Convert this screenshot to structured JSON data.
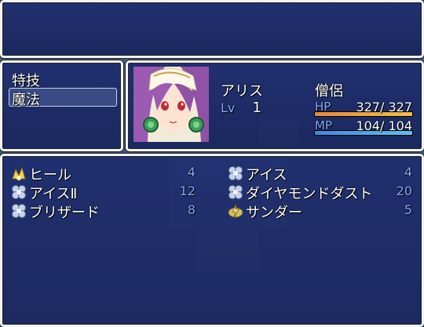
{
  "help_window": {
    "text": ""
  },
  "skill_types": {
    "items": [
      {
        "label": "特技"
      },
      {
        "label": "魔法"
      }
    ],
    "selected_index": 1
  },
  "actor": {
    "name": "アリス",
    "class": "僧侶",
    "level_label": "Lv",
    "level": "1",
    "hp_label": "HP",
    "hp_value": "327/ 327",
    "hp_ratio": 1.0,
    "mp_label": "MP",
    "mp_value": "104/ 104",
    "mp_ratio": 1.0
  },
  "skills": [
    {
      "name": "ヒール",
      "cost": "4",
      "icon": "healing-icon"
    },
    {
      "name": "アイス",
      "cost": "4",
      "icon": "ice-icon"
    },
    {
      "name": "アイスⅡ",
      "cost": "12",
      "icon": "ice-icon"
    },
    {
      "name": "ダイヤモンドダスト",
      "cost": "20",
      "icon": "ice-icon"
    },
    {
      "name": "ブリザード",
      "cost": "8",
      "icon": "ice-icon"
    },
    {
      "name": "サンダー",
      "cost": "5",
      "icon": "thunder-icon"
    }
  ],
  "colors": {
    "hp_gauge": "#e8873c",
    "hp_gauge_end": "#f0c048",
    "mp_gauge": "#3f86e0",
    "mp_gauge_end": "#5ec4ef",
    "system_text": "#84aaff",
    "mp_cost_text": "#84aaff"
  }
}
